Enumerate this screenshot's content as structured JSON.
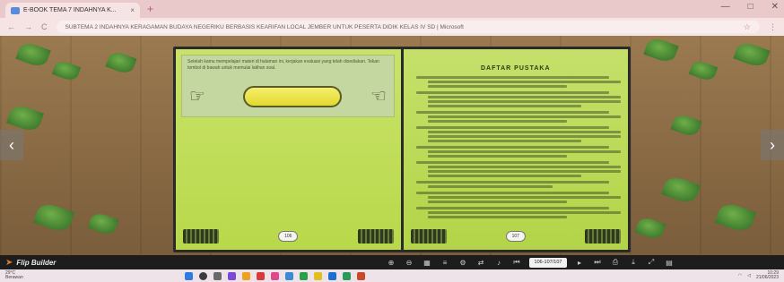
{
  "browser": {
    "tab_title": "E-BOOK TEMA 7 INDAHNYA K...",
    "tab_close": "×",
    "new_tab": "+",
    "window_controls": [
      "—",
      "□",
      "✕"
    ],
    "nav_back": "←",
    "nav_forward": "→",
    "nav_reload": "C",
    "url_text": "SUBTEMA 2 INDAHNYA KERAGAMAN BUDAYA NEGERIKU BERBASIS KEARIFAN LOCAL JEMBER UNTUK PESERTA DIDIK KELAS IV SD | Microsoft",
    "menu_icon": "⋮"
  },
  "book": {
    "left_page": {
      "text": "Setelah kamu mempelajari materi di halaman ini, kerjakan evaluasi yang telah disediakan. Tekan tombol di bawah untuk memulai latihan soal.",
      "page_number": "106"
    },
    "right_page": {
      "heading": "DAFTAR PUSTAKA",
      "references": [
        3,
        4,
        3,
        4,
        3,
        4,
        2,
        3,
        3
      ],
      "page_number": "107"
    }
  },
  "toolbar": {
    "brand": "Flip Builder",
    "page_indicator": "106-107/107",
    "buttons": [
      "zoom-in",
      "zoom-out",
      "grid",
      "toc",
      "settings",
      "share",
      "sound",
      "first",
      "prev",
      "next",
      "last",
      "print",
      "fullscreen",
      "download",
      "expand",
      "close"
    ]
  },
  "taskbar": {
    "weather_temp": "29°C",
    "weather_desc": "Berawan",
    "time": "10:29",
    "date": "21/06/2023"
  }
}
